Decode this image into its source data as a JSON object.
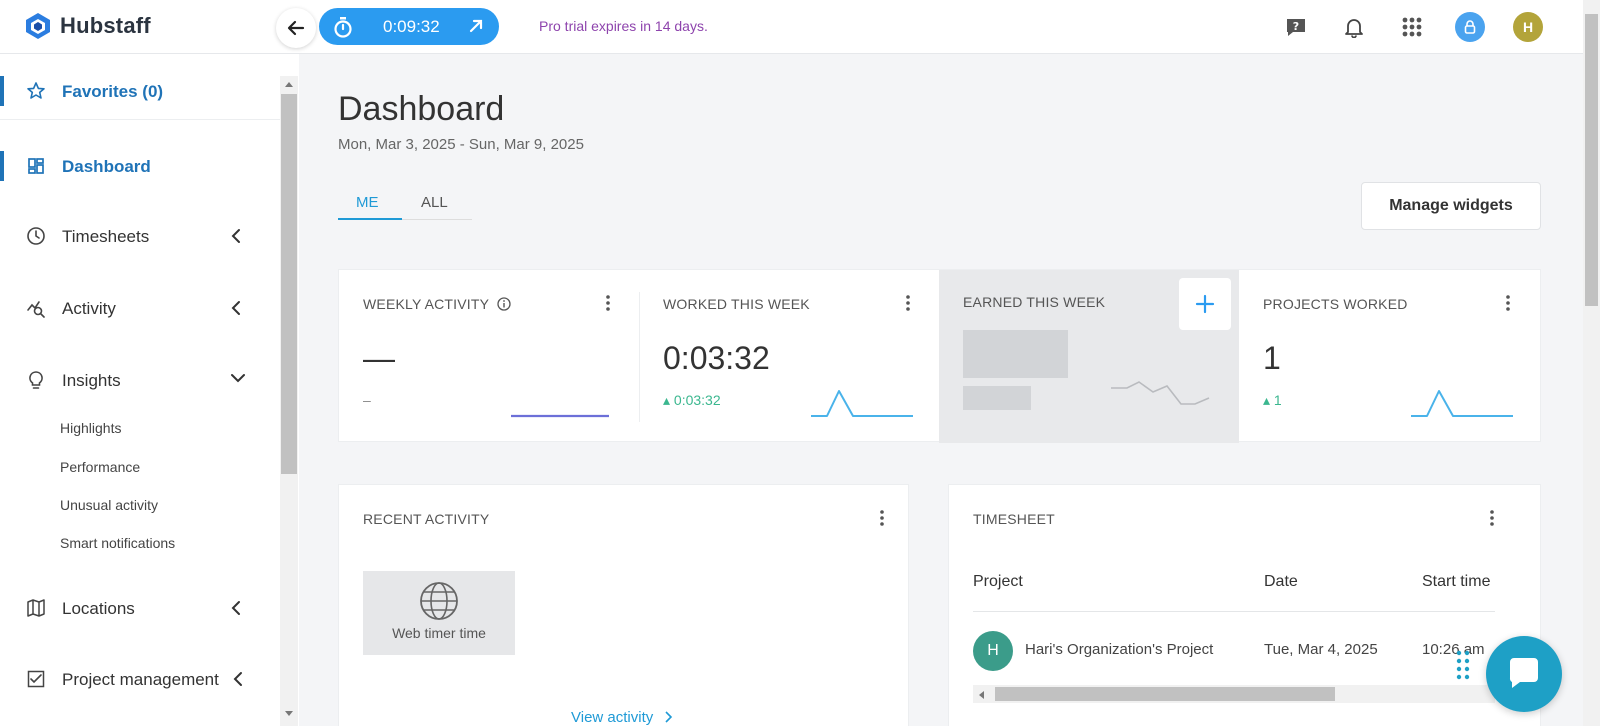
{
  "app": {
    "name": "Hubstaff"
  },
  "topbar": {
    "timer": "0:09:32",
    "trial_notice": "Pro trial expires in 14 days.",
    "user_initial": "H",
    "icons": [
      "help-icon",
      "bell-icon",
      "apps-grid-icon",
      "lock-icon"
    ]
  },
  "sidebar": {
    "favorites": "Favorites (0)",
    "items": [
      {
        "label": "Dashboard",
        "icon": "dashboard-icon",
        "active": true
      },
      {
        "label": "Timesheets",
        "icon": "clock-icon"
      },
      {
        "label": "Activity",
        "icon": "activity-icon"
      },
      {
        "label": "Insights",
        "icon": "lightbulb-icon",
        "expanded": true
      },
      {
        "label": "Locations",
        "icon": "map-icon"
      },
      {
        "label": "Project management",
        "icon": "checklist-icon"
      }
    ],
    "insights_sub": [
      "Highlights",
      "Performance",
      "Unusual activity",
      "Smart notifications"
    ]
  },
  "main": {
    "title": "Dashboard",
    "date_range": "Mon, Mar 3, 2025 - Sun, Mar 9, 2025",
    "tabs": [
      "ME",
      "ALL"
    ],
    "active_tab": "ME",
    "manage_widgets": "Manage widgets",
    "stats": [
      {
        "title": "WEEKLY ACTIVITY",
        "value": "—",
        "delta": "–"
      },
      {
        "title": "WORKED THIS WEEK",
        "value": "0:03:32",
        "delta": "▴ 0:03:32"
      },
      {
        "title": "EARNED THIS WEEK",
        "value": "",
        "delta": ""
      },
      {
        "title": "PROJECTS WORKED",
        "value": "1",
        "delta": "▴ 1"
      }
    ],
    "recent_activity": {
      "title": "RECENT ACTIVITY",
      "tile_label": "Web timer time",
      "link": "View activity"
    },
    "timesheet": {
      "title": "TIMESHEET",
      "columns": [
        "Project",
        "Date",
        "Start time"
      ],
      "rows": [
        {
          "initial": "H",
          "project": "Hari's Organization's Project",
          "date": "Tue, Mar 4, 2025",
          "start": "10:26 am"
        }
      ]
    }
  },
  "colors": {
    "accent": "#1f73b7",
    "timer": "#2b9bf0",
    "trial": "#8e44ad",
    "positive": "#3bb78f"
  }
}
